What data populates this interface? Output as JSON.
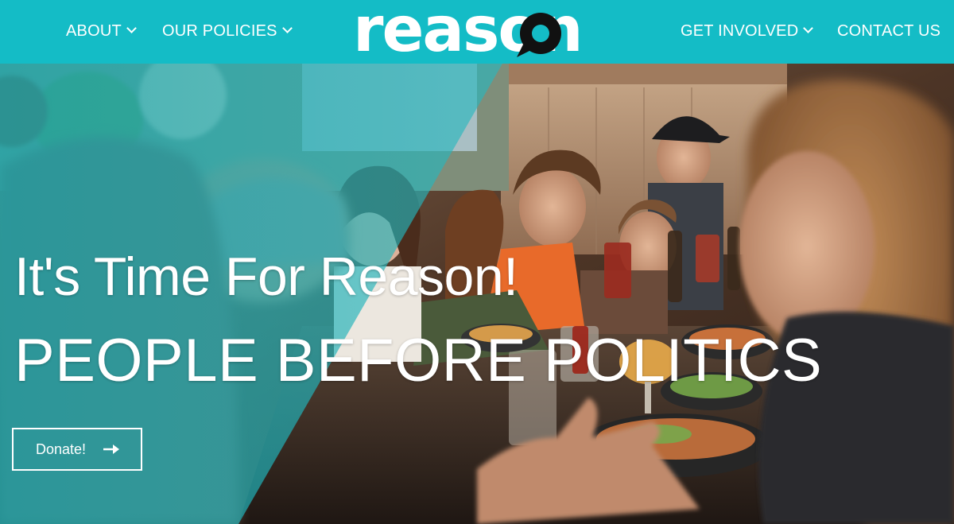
{
  "header": {
    "brand": "reason",
    "nav_left": [
      {
        "label": "ABOUT"
      },
      {
        "label": "OUR POLICIES"
      }
    ],
    "nav_right": [
      {
        "label": "GET INVOLVED"
      },
      {
        "label": "CONTACT US"
      }
    ]
  },
  "hero": {
    "headline": "It's Time For Reason!",
    "subheadline": "PEOPLE BEFORE POLITICS",
    "donate_label": "Donate!",
    "donate_icon": "arrow-right-icon"
  },
  "colors": {
    "brand_teal": "#14bcc6",
    "logo_dark": "#111111",
    "text_white": "#ffffff"
  }
}
